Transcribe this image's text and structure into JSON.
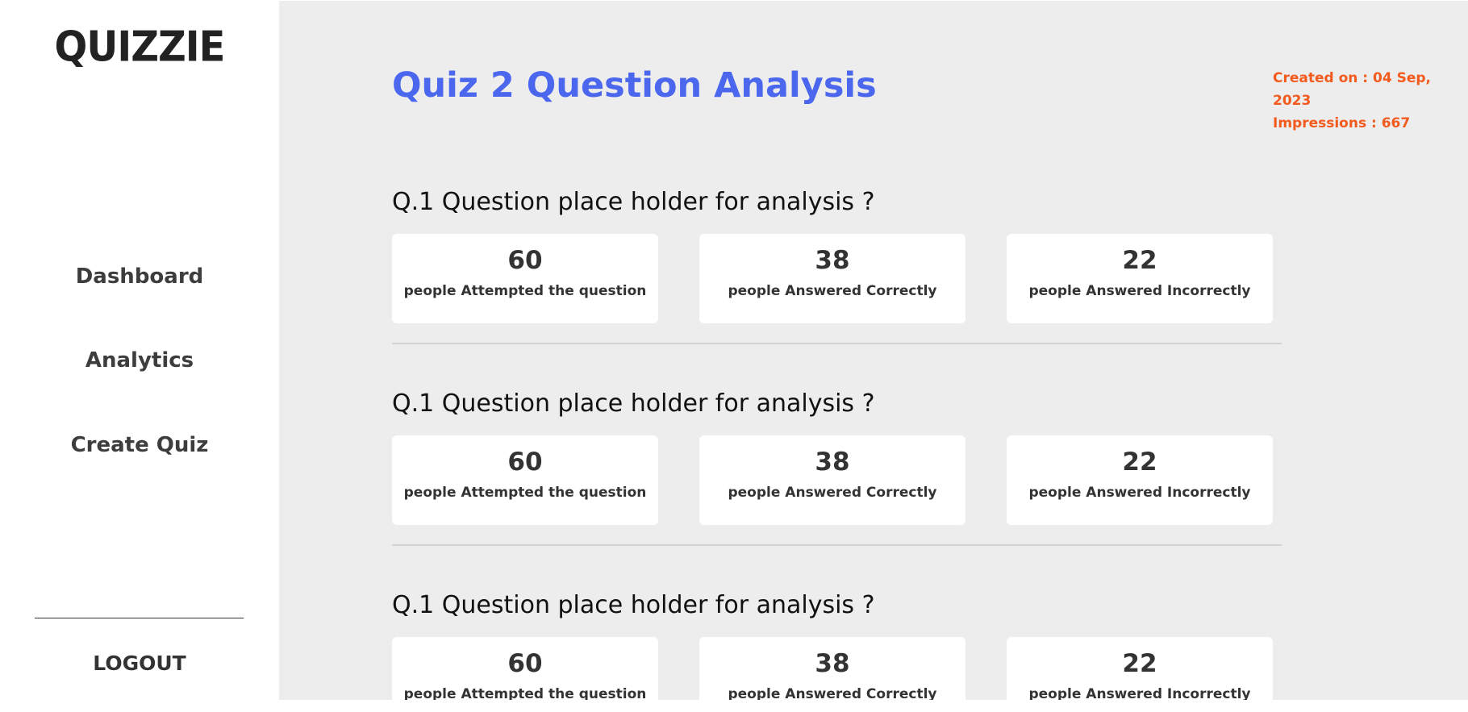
{
  "sidebar": {
    "logo": "QUIZZIE",
    "nav": {
      "dashboard": "Dashboard",
      "analytics": "Analytics",
      "create_quiz": "Create Quiz"
    },
    "logout": "LOGOUT"
  },
  "main": {
    "title": "Quiz 2 Question Analysis",
    "created_on": "Created on : 04 Sep, 2023",
    "impressions": "Impressions : 667"
  },
  "questions": [
    {
      "text": "Q.1 Question place holder for analysis ?",
      "attempted_value": "60",
      "attempted_label": "people Attempted the question",
      "correct_value": "38",
      "correct_label": "people Answered Correctly",
      "incorrect_value": "22",
      "incorrect_label": "people Answered Incorrectly"
    },
    {
      "text": "Q.1 Question place holder for analysis ?",
      "attempted_value": "60",
      "attempted_label": "people Attempted the question",
      "correct_value": "38",
      "correct_label": "people Answered Correctly",
      "incorrect_value": "22",
      "incorrect_label": "people Answered Incorrectly"
    },
    {
      "text": "Q.1 Question place holder for analysis ?",
      "attempted_value": "60",
      "attempted_label": "people Attempted the question",
      "correct_value": "38",
      "correct_label": "people Answered Correctly",
      "incorrect_value": "22",
      "incorrect_label": "people Answered Incorrectly"
    }
  ],
  "colors": {
    "title": "#4a67ee",
    "meta": "#f25a1e",
    "main_bg": "#ededed",
    "card_bg": "#ffffff"
  }
}
